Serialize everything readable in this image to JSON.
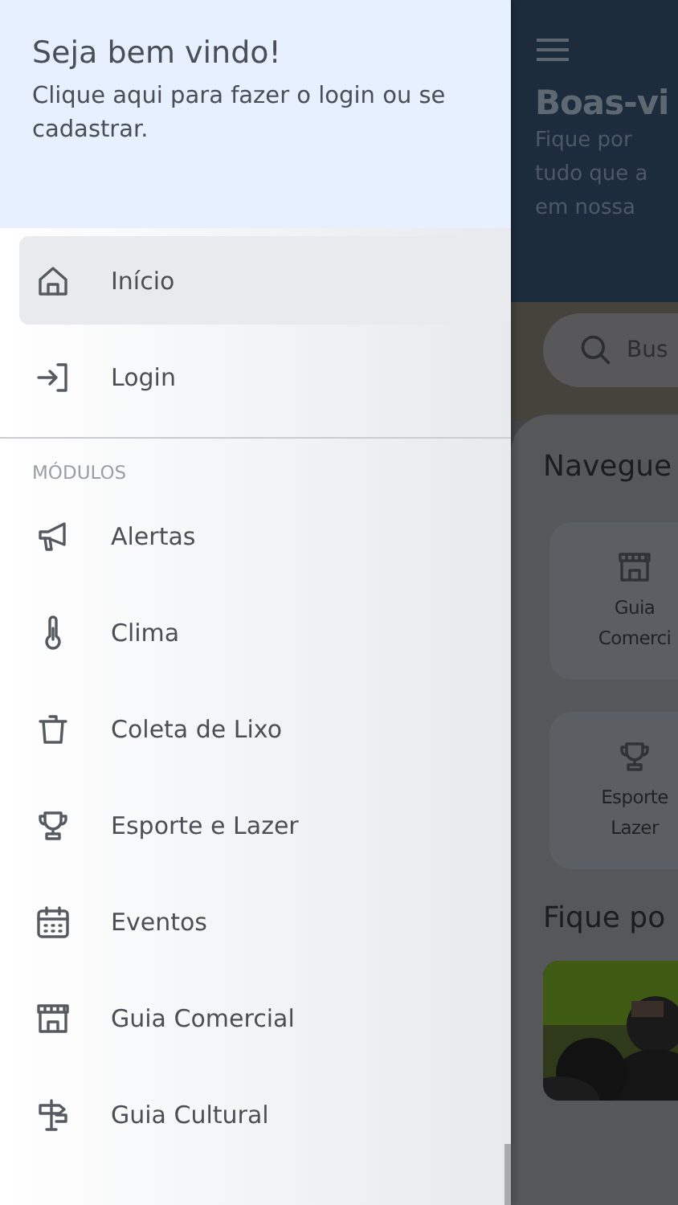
{
  "drawer": {
    "title": "Seja bem vindo!",
    "subtitle": "Clique aqui para fazer o login ou se cadastrar.",
    "top_items": [
      {
        "label": "Início",
        "selected": true
      },
      {
        "label": "Login",
        "selected": false
      }
    ],
    "section_label": "MÓDULOS",
    "modules": [
      {
        "label": "Alertas",
        "selected": false
      },
      {
        "label": "Clima",
        "selected": false
      },
      {
        "label": "Coleta de Lixo",
        "selected": false
      },
      {
        "label": "Esporte e Lazer",
        "selected": false
      },
      {
        "label": "Eventos",
        "selected": false
      },
      {
        "label": "Guia Comercial",
        "selected": false
      },
      {
        "label": "Guia Cultural",
        "selected": false
      }
    ]
  },
  "background": {
    "title": "Boas-vi",
    "subtitle_lines": [
      "Fique por",
      "tudo que a",
      "em nossa"
    ],
    "search": {
      "placeholder": "Bus"
    },
    "section_1": "Navegue",
    "cards": [
      {
        "lines": [
          "Guia",
          "Comerci"
        ]
      },
      {
        "lines": [
          "Esporte",
          "Lazer"
        ]
      }
    ],
    "section_2": "Fique po"
  }
}
